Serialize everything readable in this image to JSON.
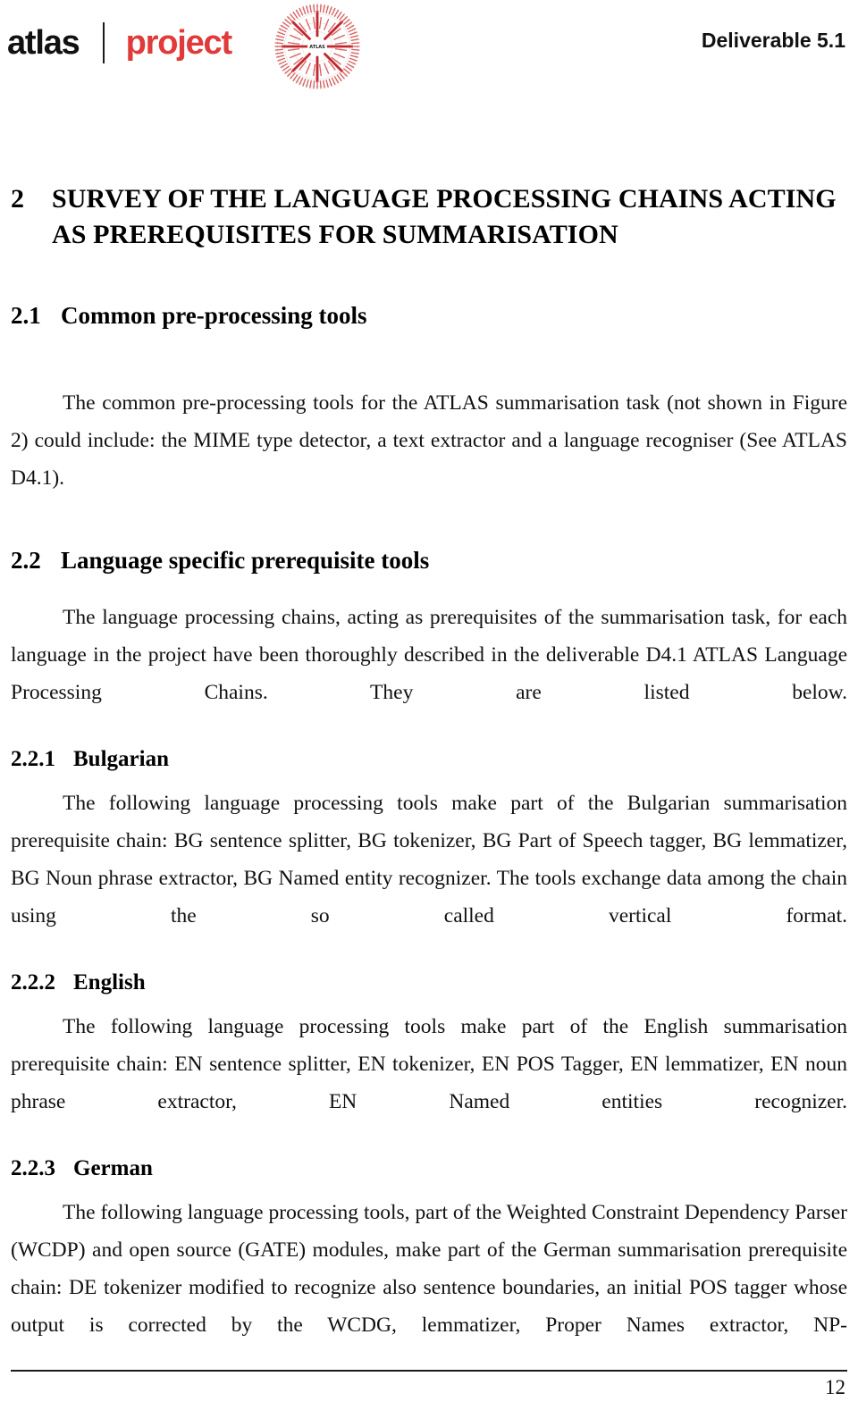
{
  "header": {
    "brand_atlas": "atlas",
    "brand_project": "project",
    "deliverable_label": "Deliverable 5.1",
    "logo_center_text": "ATLAS",
    "accent_color": "#e03a3a"
  },
  "chapter": {
    "number": "2",
    "title": "SURVEY OF THE LANGUAGE PROCESSING CHAINS ACTING AS PREREQUISITES FOR SUMMARISATION"
  },
  "sections": [
    {
      "number": "2.1",
      "title": "Common pre-processing tools",
      "paragraph": "The common pre-processing tools for the ATLAS summarisation task (not shown in Figure 2) could include: the MIME type detector, a text extractor and a language recogniser (See ATLAS D4.1)."
    },
    {
      "number": "2.2",
      "title": "Language specific prerequisite tools",
      "paragraph": "The language processing chains, acting as prerequisites of the summarisation task, for each language in the project have been thoroughly described in the deliverable D4.1 ATLAS Language Processing Chains. They are listed below."
    }
  ],
  "subsections": [
    {
      "number": "2.2.1",
      "title": "Bulgarian",
      "paragraph": "The following language processing tools make part of the Bulgarian summarisation prerequisite chain: BG sentence splitter, BG tokenizer, BG Part of Speech tagger, BG lemmatizer, BG Noun phrase extractor, BG Named entity recognizer. The tools exchange data among the chain using the so called vertical format."
    },
    {
      "number": "2.2.2",
      "title": "English",
      "paragraph": "The following language processing tools make part of the English summarisation prerequisite chain: EN sentence splitter, EN tokenizer, EN POS Tagger, EN lemmatizer, EN noun phrase extractor, EN Named entities recognizer."
    },
    {
      "number": "2.2.3",
      "title": "German",
      "paragraph": "The following language processing tools, part of the Weighted Constraint Dependency Parser (WCDP) and open source (GATE) modules, make part of the German summarisation prerequisite chain: DE tokenizer modified to recognize also sentence boundaries, an initial POS tagger whose output is corrected by the WCDG, lemmatizer, Proper Names extractor, NP-"
    }
  ],
  "footer": {
    "page_number": "12"
  }
}
